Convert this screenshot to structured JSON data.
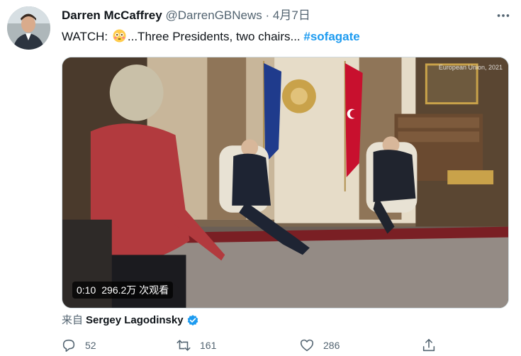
{
  "tweet": {
    "author_name": "Darren McCaffrey",
    "author_handle": "@DarrenGBNews",
    "separator": "·",
    "date": "4月7日",
    "text_prefix": "WATCH: ",
    "text_body": "...Three Presidents, two chairs... ",
    "hashtag": "#sofagate"
  },
  "media": {
    "watermark": "European Union, 2021",
    "time": "0:10",
    "views": "296.2万 次观看"
  },
  "attribution": {
    "prefix": "来自",
    "name": "Sergey Lagodinsky"
  },
  "actions": {
    "replies": "52",
    "retweets": "161",
    "likes": "286"
  },
  "colors": {
    "accent": "#1d9bf0",
    "muted": "#536471",
    "text": "#0f1419"
  },
  "icons": [
    "more-icon",
    "flushed-face-emoji",
    "verified-badge-icon",
    "reply-icon",
    "retweet-icon",
    "like-icon",
    "share-icon"
  ]
}
